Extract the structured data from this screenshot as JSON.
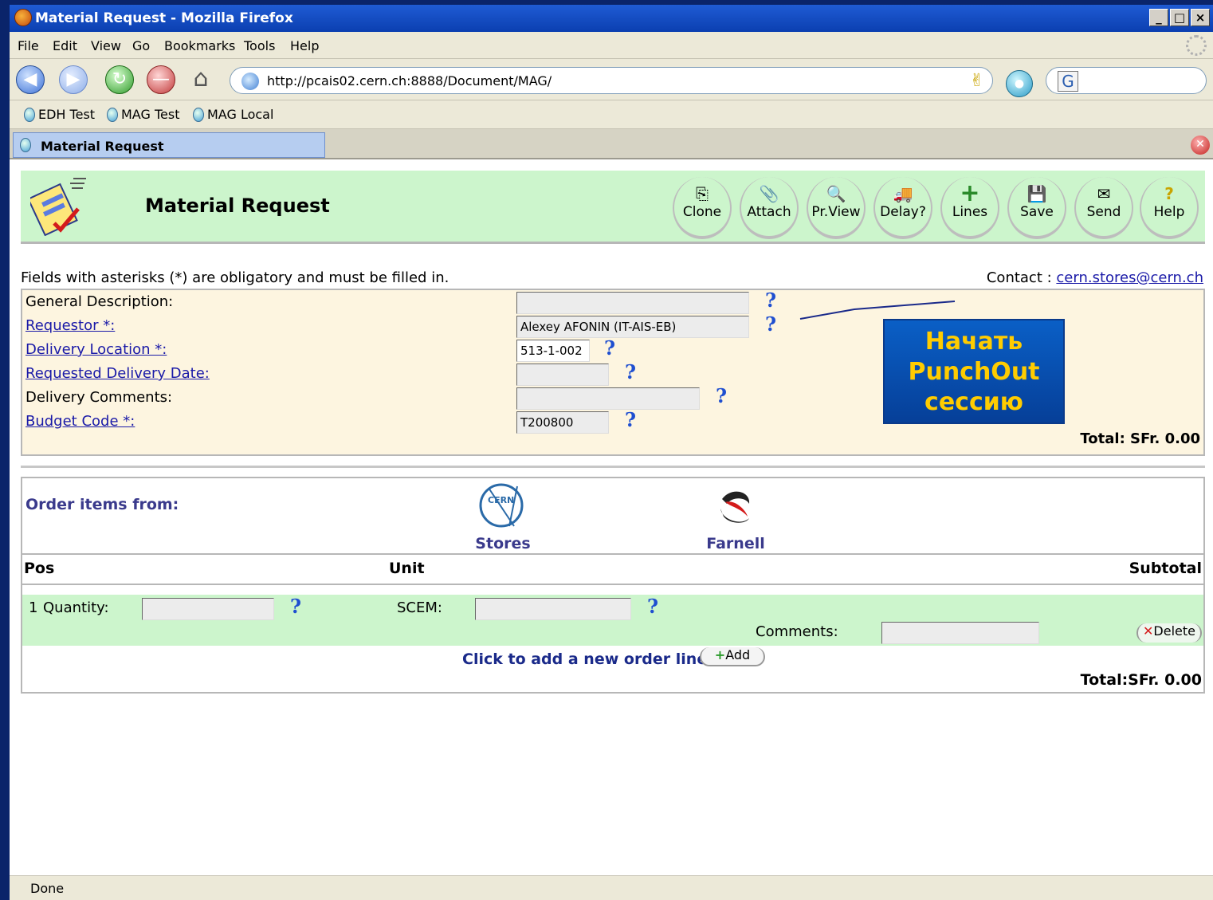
{
  "window": {
    "title": "Material Request - Mozilla Firefox",
    "buttons": [
      "_",
      "□",
      "×"
    ]
  },
  "menu": [
    "File",
    "Edit",
    "View",
    "Go",
    "Bookmarks",
    "Tools",
    "Help"
  ],
  "nav": {
    "url": "http://pcais02.cern.ch:8888/Document/MAG/",
    "search_engine_icon": "G"
  },
  "bookmarks": [
    "EDH Test",
    "MAG Test",
    "MAG Local"
  ],
  "tab": {
    "label": "Material Request"
  },
  "header": {
    "title": "Material Request",
    "buttons": [
      {
        "label": "Clone",
        "icon": "clone-icon",
        "glyph": "⎘"
      },
      {
        "label": "Attach",
        "icon": "paperclip-icon",
        "glyph": "📎"
      },
      {
        "label": "Pr.View",
        "icon": "print-preview-icon",
        "glyph": "🔍"
      },
      {
        "label": "Delay?",
        "icon": "truck-icon",
        "glyph": "🚚"
      },
      {
        "label": "Lines",
        "icon": "plus-icon",
        "glyph": "+"
      },
      {
        "label": "Save",
        "icon": "floppy-icon",
        "glyph": "💾"
      },
      {
        "label": "Send",
        "icon": "envelope-icon",
        "glyph": "✉"
      },
      {
        "label": "Help",
        "icon": "help-icon",
        "glyph": "?"
      }
    ]
  },
  "form": {
    "note": "Fields with asterisks (*) are obligatory and must be filled in.",
    "contact_label": "Contact : ",
    "contact_email": "cern.stores@cern.ch",
    "fields": [
      {
        "label": "General Description:",
        "value": "",
        "link": false
      },
      {
        "label": "Requestor *:",
        "value": "Alexey AFONIN (IT-AIS-EB)",
        "link": true
      },
      {
        "label": "Delivery Location *:",
        "value": "513-1-002",
        "link": true
      },
      {
        "label": "Requested Delivery Date:",
        "value": "",
        "link": true
      },
      {
        "label": "Delivery Comments:",
        "value": "",
        "link": false
      },
      {
        "label": "Budget Code *:",
        "value": "T200800",
        "link": true
      }
    ],
    "help_glyph": "?",
    "total": "Total: SFr. 0.00"
  },
  "annotation": {
    "text_line1": "Начать",
    "text_line2": "PunchOut",
    "text_line3": "сессию"
  },
  "order": {
    "from_label": "Order items from:",
    "suppliers": [
      {
        "name": "Stores",
        "logo_text": "CERN"
      },
      {
        "name": "Farnell"
      }
    ],
    "columns": [
      "Pos",
      "Unit",
      "Subtotal"
    ],
    "line": {
      "pos": "1",
      "quantity_label": "Quantity:",
      "quantity_value": "",
      "scem_label": "SCEM:",
      "scem_value": "",
      "comments_label": "Comments:",
      "comments_value": "",
      "delete_label": "Delete"
    },
    "add_text": "Click to add a new order line",
    "add_label": "Add",
    "total": "Total:SFr. 0.00"
  },
  "status": {
    "text": "Done"
  }
}
